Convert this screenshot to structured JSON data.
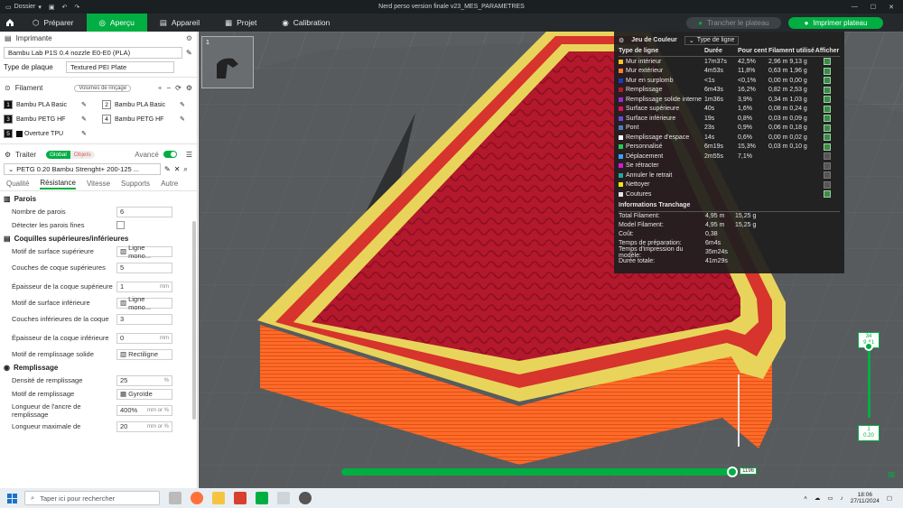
{
  "titlebar": {
    "menu_label": "Dossier",
    "title": "Nerd perso version finale v23_MES_PARAMETRES"
  },
  "topbar": {
    "tabs": [
      {
        "label": "Préparer"
      },
      {
        "label": "Aperçu"
      },
      {
        "label": "Appareil"
      },
      {
        "label": "Projet"
      },
      {
        "label": "Calibration"
      }
    ],
    "slice_label": "Trancher le plateau",
    "print_label": "Imprimer plateau"
  },
  "sidebar": {
    "printer_header": "Imprimante",
    "printer_value": "Bambu Lab P1S 0.4 nozzle E0-E0 (PLA)",
    "plate_label": "Type de plaque",
    "plate_value": "Textured PEI Plate",
    "filament_header": "Filament",
    "volumes_label": "Volumes de rinçage",
    "filaments": [
      {
        "num": "1",
        "name": "Bambu PLA Basic",
        "color": "#111111"
      },
      {
        "num": "2",
        "name": "Bambu PLA Basic",
        "color": "#ffffff"
      },
      {
        "num": "3",
        "name": "Bambu PETG HF",
        "color": "#111111"
      },
      {
        "num": "4",
        "name": "Bambu PETG HF",
        "color": "#ffffff"
      },
      {
        "num": "5",
        "name": "Overture TPU",
        "color": "#111111"
      }
    ],
    "process_header": "Traiter",
    "global_label": "Global",
    "objects_label": "Objets",
    "advanced_label": "Avancé",
    "process_value": "PETG 0.20 Bambu Strenght+ 200-125 ...",
    "subtabs": [
      "Qualité",
      "Résistance",
      "Vitesse",
      "Supports",
      "Autre"
    ],
    "walls_header": "Parois",
    "walls_count_label": "Nombre de parois",
    "walls_count_value": "6",
    "thin_walls_label": "Détecter les parois fines",
    "shells_header": "Coquilles supérieures/inférieures",
    "top_pattern_label": "Motif de surface supérieure",
    "top_pattern_value": "Ligne mono...",
    "top_layers_label": "Couches de coque supérieures",
    "top_layers_value": "5",
    "top_thickness_label": "Épaisseur de la coque supérieure",
    "top_thickness_value": "1",
    "bottom_pattern_label": "Motif de surface inférieure",
    "bottom_pattern_value": "Ligne mono...",
    "bottom_layers_label": "Couches inférieures de la coque",
    "bottom_layers_value": "3",
    "bottom_thickness_label": "Épaisseur de la coque inférieure",
    "bottom_thickness_value": "0",
    "solid_pattern_label": "Motif de remplissage solide",
    "solid_pattern_value": "Rectiligne",
    "infill_header": "Remplissage",
    "density_label": "Densité de remplissage",
    "density_value": "25",
    "infill_pattern_label": "Motif de remplissage",
    "infill_pattern_value": "Gyroïde",
    "anchor_label": "Longueur de l'ancre de remplissage",
    "anchor_value": "400%",
    "anchor_max_label": "Longueur maximale de",
    "anchor_max_value": "20",
    "unit_mm": "mm",
    "unit_pct": "%",
    "unit_mm_or_pct": "mm or %"
  },
  "viewport": {
    "thumb_number": "1",
    "layer_top": "34",
    "layer_top_height": "9.41",
    "layer_bottom": "1",
    "layer_bottom_height": "0.20",
    "move_value": "1196"
  },
  "legend": {
    "scheme_label": "Jeu de Couleur",
    "scheme_value": "Type de ligne",
    "headers": [
      "Type de ligne",
      "Durée",
      "Pour cent",
      "Filament utilisé",
      "Afficher"
    ],
    "rows": [
      {
        "name": "Mur intérieur",
        "time": "17m37s",
        "pct": "42,5%",
        "fil": "2,96 m   9,13 g",
        "color": "#f5c526",
        "on": true
      },
      {
        "name": "Mur extérieur",
        "time": "4m53s",
        "pct": "11,8%",
        "fil": "0,63 m   1,96 g",
        "color": "#ff7d38",
        "on": true
      },
      {
        "name": "Mur en surplomb",
        "time": "<1s",
        "pct": "<0,1%",
        "fil": "0,00 m   0,00 g",
        "color": "#2137c5",
        "on": true
      },
      {
        "name": "Remplissage",
        "time": "6m43s",
        "pct": "16,2%",
        "fil": "0,82 m   2,53 g",
        "color": "#b3182c",
        "on": true
      },
      {
        "name": "Remplissage solide interne",
        "time": "1m36s",
        "pct": "3,9%",
        "fil": "0,34 m   1,03 g",
        "color": "#9a2ccf",
        "on": true
      },
      {
        "name": "Surface supérieure",
        "time": "40s",
        "pct": "1,6%",
        "fil": "0,08 m   0,24 g",
        "color": "#e3105e",
        "on": true
      },
      {
        "name": "Surface inférieure",
        "time": "19s",
        "pct": "0,8%",
        "fil": "0,03 m   0,09 g",
        "color": "#6a4bd8",
        "on": true
      },
      {
        "name": "Pont",
        "time": "23s",
        "pct": "0,9%",
        "fil": "0,06 m   0,18 g",
        "color": "#4d80ba",
        "on": true
      },
      {
        "name": "Remplissage d'espace",
        "time": "14s",
        "pct": "0,6%",
        "fil": "0,00 m   0,02 g",
        "color": "#ffffff",
        "on": true
      },
      {
        "name": "Personnalisé",
        "time": "6m19s",
        "pct": "15,3%",
        "fil": "0,03 m   0,10 g",
        "color": "#26cc52",
        "on": true
      },
      {
        "name": "Déplacement",
        "time": "2m55s",
        "pct": "7,1%",
        "fil": "",
        "color": "#3aa0ff",
        "on": false
      },
      {
        "name": "Se rétracter",
        "time": "",
        "pct": "",
        "fil": "",
        "color": "#d21ad2",
        "on": false
      },
      {
        "name": "Annuler le retrait",
        "time": "",
        "pct": "",
        "fil": "",
        "color": "#1fa7a7",
        "on": false
      },
      {
        "name": "Nettoyer",
        "time": "",
        "pct": "",
        "fil": "",
        "color": "#f2e313",
        "on": false
      },
      {
        "name": "Coutures",
        "time": "",
        "pct": "",
        "fil": "",
        "color": "#e6e6e6",
        "on": true
      }
    ],
    "info_header": "Informations Tranchage",
    "info": [
      {
        "k": "Total Filament:",
        "v1": "4,95 m",
        "v2": "15,25 g"
      },
      {
        "k": "Model Filament:",
        "v1": "4,95 m",
        "v2": "15,25 g"
      },
      {
        "k": "Coût:",
        "v1": "0,38",
        "v2": ""
      },
      {
        "k": "Temps de préparation:",
        "v1": "6m4s",
        "v2": ""
      },
      {
        "k": "Temps d'impression du modèle:",
        "v1": "35m24s",
        "v2": ""
      },
      {
        "k": "Durée totale:",
        "v1": "41m29s",
        "v2": ""
      }
    ]
  },
  "taskbar": {
    "search_placeholder": "Taper ici pour rechercher",
    "time": "18:06",
    "date": "27/11/2024"
  }
}
